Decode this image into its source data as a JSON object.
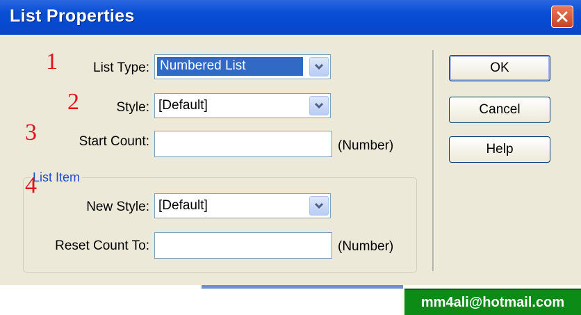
{
  "window": {
    "title": "List Properties"
  },
  "annotations": [
    "1",
    "2",
    "3",
    "4"
  ],
  "fields": {
    "list_type": {
      "label": "List Type:",
      "value": "Numbered List"
    },
    "style": {
      "label": "Style:",
      "value": "[Default]"
    },
    "start_count": {
      "label": "Start Count:",
      "value": "",
      "unit": "(Number)"
    }
  },
  "list_item": {
    "legend": "List Item",
    "new_style": {
      "label": "New Style:",
      "value": "[Default]"
    },
    "reset_count": {
      "label": "Reset Count To:",
      "value": "",
      "unit": "(Number)"
    }
  },
  "buttons": {
    "ok": "OK",
    "cancel": "Cancel",
    "help": "Help"
  },
  "watermark": "mm4ali@hotmail.com",
  "colors": {
    "titlebar": "#0a4fd6",
    "dialog_bg": "#ece9d8",
    "annotation": "#e3141c",
    "selection": "#316ac5",
    "watermark_bg": "#0c8c17"
  },
  "icons": {
    "close": "close-icon",
    "dropdown": "chevron-down-icon"
  }
}
